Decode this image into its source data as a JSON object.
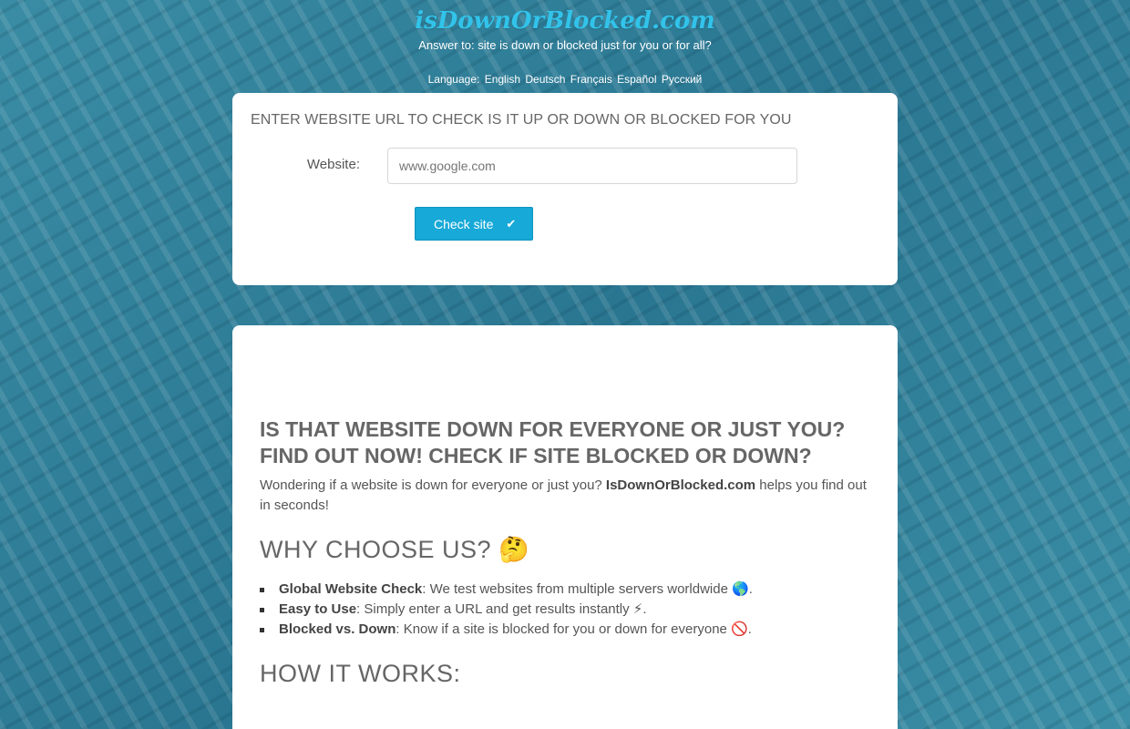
{
  "header": {
    "logo": "isDownOrBlocked.com",
    "tagline": "Answer to: site is down or blocked just for you or for all?",
    "language_label": "Language:",
    "languages": [
      "English",
      "Deutsch",
      "Français",
      "Español",
      "Русский"
    ]
  },
  "check_form": {
    "heading": "ENTER WEBSITE URL TO CHECK IS IT UP OR DOWN OR BLOCKED FOR YOU",
    "website_label": "Website:",
    "website_placeholder": "www.google.com",
    "button_label": "Check site",
    "button_icon": "check-icon"
  },
  "content": {
    "headline": "IS THAT WEBSITE DOWN FOR EVERYONE OR JUST YOU? FIND OUT NOW! CHECK IF SITE BLOCKED OR DOWN?",
    "intro_before": "Wondering if a website is down for everyone or just you? ",
    "intro_brand": "IsDownOrBlocked.com",
    "intro_after": " helps you find out in seconds!",
    "why_heading": "WHY CHOOSE US? 🤔",
    "features": [
      {
        "title": "Global Website Check",
        "text": ": We test websites from multiple servers worldwide 🌎."
      },
      {
        "title": "Easy to Use",
        "text": ": Simply enter a URL and get results instantly ⚡."
      },
      {
        "title": "Blocked vs. Down",
        "text": ": Know if a site is blocked for you or down for everyone 🚫."
      }
    ],
    "how_heading": "HOW IT WORKS:"
  },
  "colors": {
    "logo": "#32c3ea",
    "button": "#17a9d8",
    "background": "#2f7f96"
  }
}
